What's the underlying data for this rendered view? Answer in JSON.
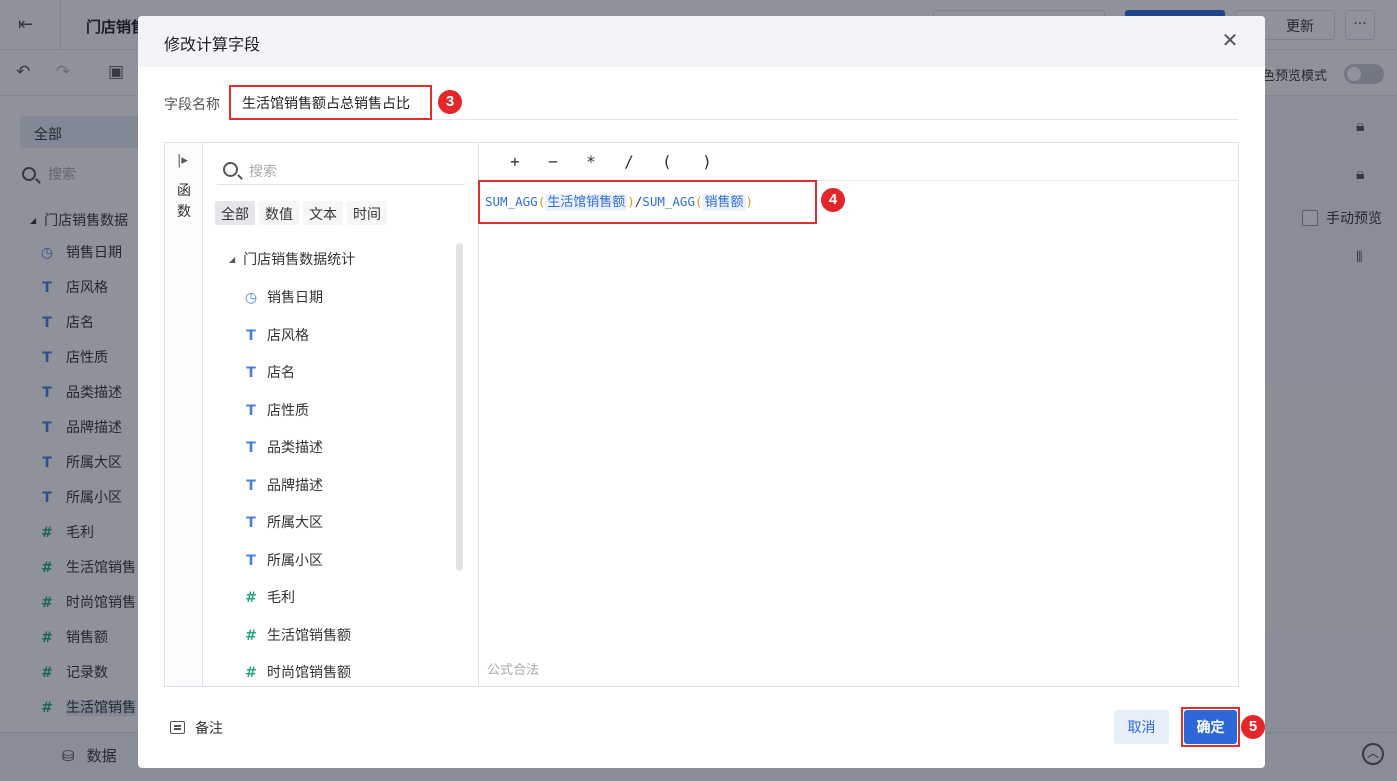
{
  "background": {
    "app_title": "门店销售",
    "update_button": "更新",
    "more_button": "···",
    "preview_label": "色预览模式",
    "left_all_tab": "全部",
    "left_search_placeholder": "搜索",
    "left_tree_root": "门店销售数据",
    "left_items": [
      {
        "icon": "clock-icon",
        "label": "销售日期"
      },
      {
        "icon": "text-field-icon",
        "label": "店风格"
      },
      {
        "icon": "text-field-icon",
        "label": "店名"
      },
      {
        "icon": "text-field-icon",
        "label": "店性质"
      },
      {
        "icon": "text-field-icon",
        "label": "品类描述"
      },
      {
        "icon": "text-field-icon",
        "label": "品牌描述"
      },
      {
        "icon": "text-field-icon",
        "label": "所属大区"
      },
      {
        "icon": "text-field-icon",
        "label": "所属小区"
      },
      {
        "icon": "number-field-icon",
        "label": "毛利"
      },
      {
        "icon": "number-field-icon",
        "label": "生活馆销售"
      },
      {
        "icon": "number-field-icon",
        "label": "时尚馆销售"
      },
      {
        "icon": "number-field-icon",
        "label": "销售额"
      },
      {
        "icon": "record-count-icon",
        "label": "记录数"
      },
      {
        "icon": "calculated-field-icon",
        "label": "生活馆销售"
      }
    ],
    "manual_preview": "手动预览",
    "bottom_data_tab": "数据"
  },
  "dialog": {
    "title": "修改计算字段",
    "field_name_label": "字段名称",
    "field_name_value": "生活馆销售额占总销售占比",
    "side_tab_label": "函数",
    "search_placeholder": "搜索",
    "filter_tabs": [
      "全部",
      "数值",
      "文本",
      "时间"
    ],
    "tree_root": "门店销售数据统计",
    "fields": [
      {
        "icon": "clock-icon",
        "label": "销售日期"
      },
      {
        "icon": "text-field-icon",
        "label": "店风格"
      },
      {
        "icon": "text-field-icon",
        "label": "店名"
      },
      {
        "icon": "text-field-icon",
        "label": "店性质"
      },
      {
        "icon": "text-field-icon",
        "label": "品类描述"
      },
      {
        "icon": "text-field-icon",
        "label": "品牌描述"
      },
      {
        "icon": "text-field-icon",
        "label": "所属大区"
      },
      {
        "icon": "text-field-icon",
        "label": "所属小区"
      },
      {
        "icon": "number-field-icon",
        "label": "毛利"
      },
      {
        "icon": "number-field-icon",
        "label": "生活馆销售额"
      },
      {
        "icon": "number-field-icon",
        "label": "时尚馆销售额"
      }
    ],
    "operators": [
      "+",
      "−",
      "*",
      "/",
      "(",
      ")"
    ],
    "formula": {
      "func1": "SUM_AGG",
      "field1": "生活馆销售额",
      "divider": "/",
      "func2": "SUM_AGG",
      "field2": "销售额"
    },
    "formula_status": "公式合法",
    "note_label": "备注",
    "cancel_label": "取消",
    "ok_label": "确定"
  },
  "annotations": [
    "3",
    "4",
    "5"
  ],
  "colors": {
    "primary": "#2d68d9",
    "highlight_red": "#e02e2e",
    "number_field": "#27a77f"
  }
}
